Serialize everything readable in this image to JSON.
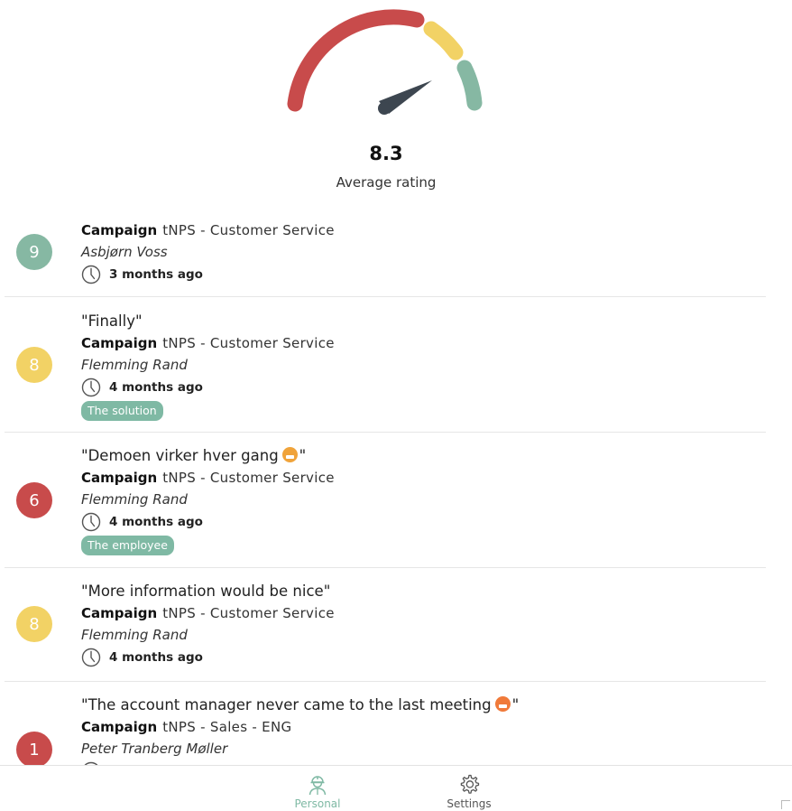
{
  "gauge": {
    "value": "8.3",
    "label": "Average rating",
    "colors": {
      "low": "#c84b4b",
      "mid": "#f2d265",
      "high": "#86b8a3",
      "needle": "#3d4650"
    }
  },
  "colors": {
    "score_high": "#86b8a3",
    "score_mid": "#f2d265",
    "score_low": "#c84b4b",
    "tag": "#7fb9a4"
  },
  "feedback": [
    {
      "score": "9",
      "score_color": "#86b8a3",
      "quote": "",
      "campaign_label": "Campaign",
      "campaign": "tNPS - Customer Service",
      "person": "Asbjørn Voss",
      "time": "3 months ago",
      "tag": ""
    },
    {
      "score": "8",
      "score_color": "#f2d265",
      "quote": "\"Finally\"",
      "campaign_label": "Campaign",
      "campaign": "tNPS - Customer Service",
      "person": "Flemming Rand",
      "time": "4 months ago",
      "tag": "The solution"
    },
    {
      "score": "6",
      "score_color": "#c84b4b",
      "quote_pre": "\"Demoen virker hver gang",
      "quote_post": "\"",
      "emoji": "grinning-face-emoji",
      "campaign_label": "Campaign",
      "campaign": "tNPS - Customer Service",
      "person": "Flemming Rand",
      "time": "4 months ago",
      "tag": "The employee"
    },
    {
      "score": "8",
      "score_color": "#f2d265",
      "quote": "\"More information would be nice\"",
      "campaign_label": "Campaign",
      "campaign": "tNPS - Customer Service",
      "person": "Flemming Rand",
      "time": "4 months ago",
      "tag": ""
    },
    {
      "score": "1",
      "score_color": "#c84b4b",
      "quote_pre": "\"The account manager never came to the last meeting",
      "quote_post": "\"",
      "emoji": "tired-face-emoji",
      "campaign_label": "Campaign",
      "campaign": "tNPS - Sales - ENG",
      "person": "Peter Tranberg Møller",
      "time": "",
      "tag": ""
    }
  ],
  "nav": {
    "personal": {
      "label": "Personal",
      "icon": "worker-icon",
      "active": true
    },
    "settings": {
      "label": "Settings",
      "icon": "gear-icon",
      "active": false
    }
  }
}
